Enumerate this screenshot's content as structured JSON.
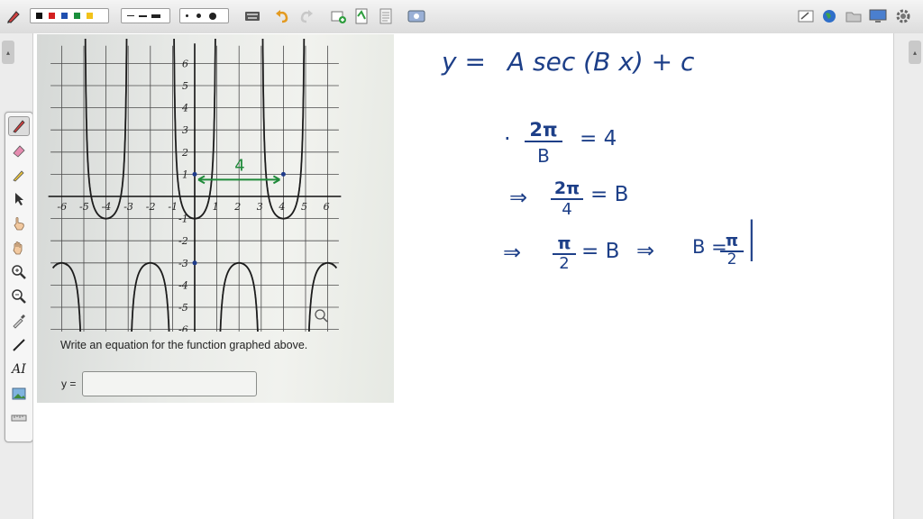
{
  "toolbar": {
    "icons": [
      "pen-icon",
      "palette-icon",
      "line-style-icon",
      "dot-size-icon",
      "keyboard-icon",
      "undo-icon",
      "redo-icon",
      "add-page-icon",
      "page-icon",
      "document-icon",
      "screenshot-icon",
      "whiteboard-icon",
      "globe-icon",
      "folder-icon",
      "monitor-icon",
      "settings-icon"
    ],
    "colors": [
      "#111111",
      "#d31f1f",
      "#1f4fb0",
      "#1b8f3c",
      "#f2c21a"
    ]
  },
  "sidebar_tools": [
    "pen",
    "eraser",
    "highlighter",
    "pointer",
    "hand-point",
    "hand-pan",
    "zoom-in",
    "zoom-out",
    "eyedropper",
    "line",
    "text",
    "image",
    "ruler"
  ],
  "sidebar_text_tool_label": "AI",
  "screenshot": {
    "prompt": "Write an equation for the function graphed above.",
    "answer_label": "y =",
    "answer_value": "",
    "x_ticks": [
      "-6",
      "-5",
      "-4",
      "-3",
      "-2",
      "-1",
      "1",
      "2",
      "3",
      "4",
      "5",
      "6"
    ],
    "y_ticks_pos": [
      "6",
      "5",
      "4",
      "3",
      "2",
      "1"
    ],
    "y_ticks_neg": [
      "-1",
      "-2",
      "-3",
      "-4",
      "-5",
      "-6"
    ],
    "annotation": "4"
  },
  "notes": {
    "line1": {
      "y": "y =",
      "expr": "A sec (B x) + c"
    },
    "line2": {
      "bullet": "·",
      "num": "2π",
      "den": "B",
      "eq": "= 4"
    },
    "line3": {
      "arrow": "⇒",
      "num": "2π",
      "den": "4",
      "eq": "= B"
    },
    "line4": {
      "arrow": "⇒",
      "num": "π",
      "den": "2",
      "eq": "= B",
      "arrow2": "⇒",
      "lhs": "B =",
      "num2": "π",
      "den2": "2",
      "bar": "|"
    }
  }
}
